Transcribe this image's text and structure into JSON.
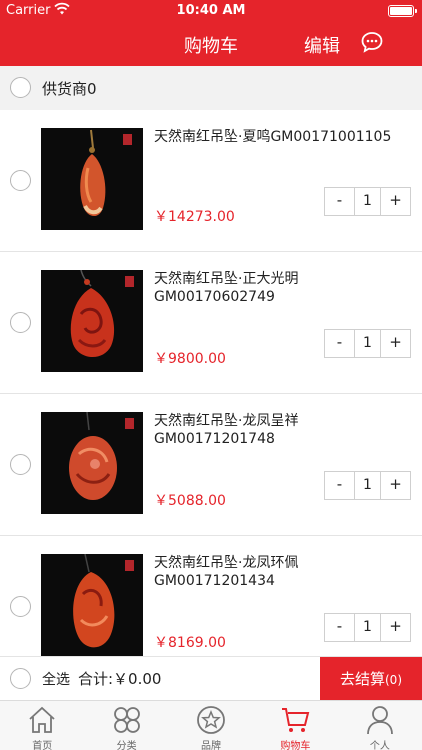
{
  "status_bar": {
    "carrier": "Carrier",
    "time": "10:40 AM"
  },
  "nav": {
    "title": "购物车",
    "edit": "编辑",
    "chat_icon": "chat-bubble-icon"
  },
  "supplier": {
    "label": "供货商0"
  },
  "items": [
    {
      "name": "天然南红吊坠·夏鸣GM00171001105",
      "price": "￥14273.00",
      "qty": "1",
      "minus": "-",
      "plus": "+"
    },
    {
      "name": "天然南红吊坠·正大光明GM00170602749",
      "price": "￥9800.00",
      "qty": "1",
      "minus": "-",
      "plus": "+"
    },
    {
      "name": "天然南红吊坠·龙凤呈祥GM00171201748",
      "price": "￥5088.00",
      "qty": "1",
      "minus": "-",
      "plus": "+"
    },
    {
      "name": "天然南红吊坠·龙凤环佩GM00171201434",
      "price": "￥8169.00",
      "qty": "1",
      "minus": "-",
      "plus": "+"
    }
  ],
  "checkout": {
    "select_all": "全选",
    "total": "合计:￥0.00",
    "button": "去结算",
    "count": "(0)"
  },
  "tabs": [
    {
      "label": "首页",
      "icon": "home-icon"
    },
    {
      "label": "分类",
      "icon": "category-icon"
    },
    {
      "label": "品牌",
      "icon": "brand-star-icon"
    },
    {
      "label": "购物车",
      "icon": "cart-icon",
      "active": true
    },
    {
      "label": "个人",
      "icon": "user-icon"
    }
  ],
  "colors": {
    "brand": "#e5242b",
    "price": "#e5242b"
  }
}
